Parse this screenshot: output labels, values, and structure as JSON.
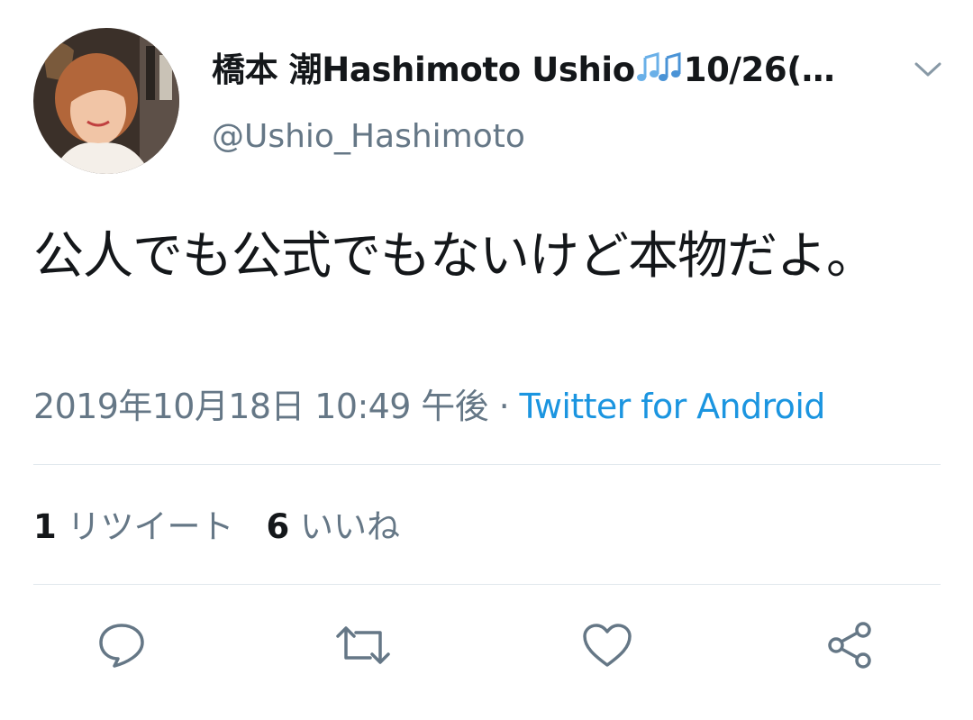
{
  "user": {
    "display_name_prefix": "橋本 潮Hashimoto Ushio",
    "display_name_suffix": "10/26(…",
    "handle": "@Ushio_Hashimoto"
  },
  "tweet": {
    "text": "公人でも公式でもないけど本物だよ。",
    "timestamp": "2019年10月18日 10:49 午後",
    "separator": " · ",
    "source": "Twitter for Android"
  },
  "stats": {
    "retweets_count": "1",
    "retweets_label": "リツイート",
    "likes_count": "6",
    "likes_label": "いいね"
  },
  "icons": {
    "menu": "chevron-down-icon",
    "name_decoration": "music-notes-icon",
    "reply": "reply-icon",
    "retweet": "retweet-icon",
    "like": "heart-icon",
    "share": "share-icon"
  },
  "colors": {
    "primary_text": "#14171a",
    "secondary_text": "#657786",
    "link": "#1b95e0",
    "divider": "#e1e8ed",
    "icon": "#657786"
  }
}
